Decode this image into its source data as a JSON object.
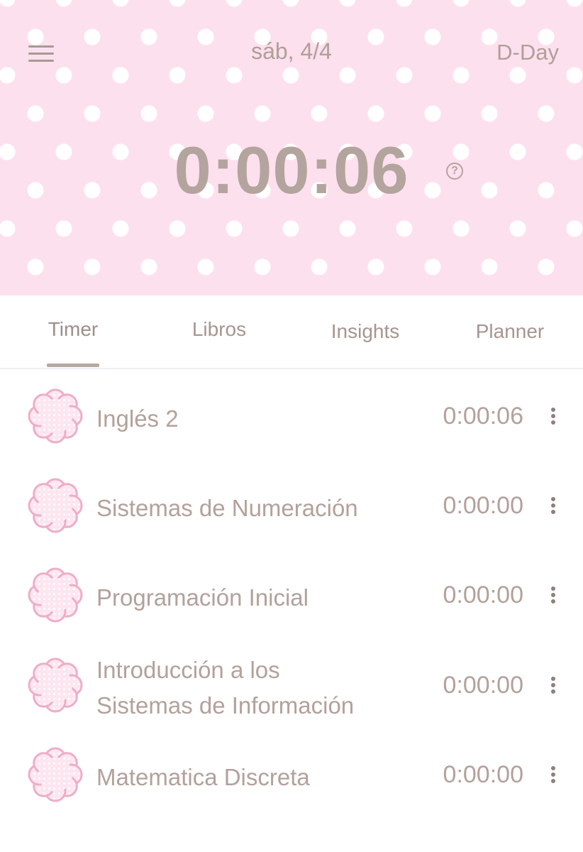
{
  "header": {
    "menu_icon": "hamburger-menu-icon",
    "date": "sáb, 4/4",
    "dday_label": "D-Day",
    "main_timer": "0:00:06",
    "help_icon": "question-circle-icon",
    "help_glyph": "?"
  },
  "tabs": [
    {
      "label": "Timer",
      "active": true
    },
    {
      "label": "Libros",
      "active": false
    },
    {
      "label": "Insights",
      "active": false
    },
    {
      "label": "Planner",
      "active": false
    }
  ],
  "subjects": [
    {
      "name": "Inglés 2",
      "time": "0:00:06",
      "icon": "flower-badge-icon"
    },
    {
      "name": "Sistemas de Numeración",
      "time": "0:00:00",
      "icon": "flower-badge-icon"
    },
    {
      "name": "Programación Inicial",
      "time": "0:00:00",
      "icon": "flower-badge-icon"
    },
    {
      "name_line1": "Introducción a los",
      "name_line2": "Sistemas de Información",
      "time": "0:00:00",
      "icon": "flower-badge-icon"
    },
    {
      "name": "Matematica Discreta",
      "time": "0:00:00",
      "icon": "flower-badge-icon"
    }
  ],
  "colors": {
    "header_bg": "#fde0ee",
    "dots": "#ffffff",
    "text": "#b3a19b",
    "flower_outline": "#eeaec8"
  }
}
